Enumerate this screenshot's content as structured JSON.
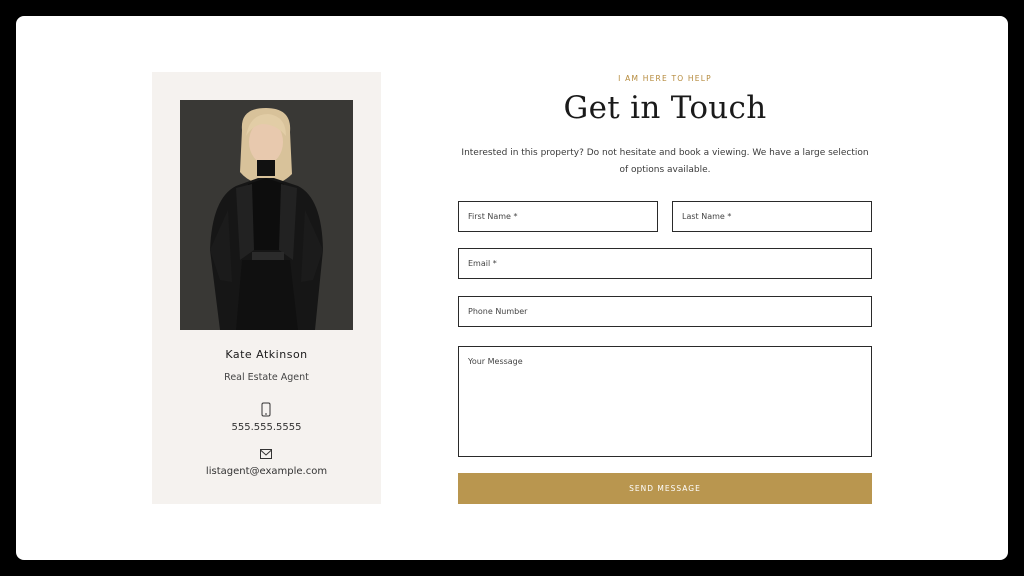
{
  "agent": {
    "name": "Kate Atkinson",
    "role": "Real Estate Agent",
    "phone": "555.555.5555",
    "email": "listagent@example.com",
    "phone_icon": "phone-icon",
    "email_icon": "mail-icon"
  },
  "contact": {
    "eyebrow": "I AM HERE TO HELP",
    "title": "Get in Touch",
    "intro": "Interested in this property? Do not hesitate and book a viewing. We have a large selection of options available.",
    "fields": {
      "first_name": "First Name *",
      "last_name": "Last Name *",
      "email": "Email *",
      "phone": "Phone Number",
      "message": "Your Message"
    },
    "submit_label": "SEND MESSAGE"
  },
  "colors": {
    "accent": "#b9964f",
    "card_background": "#f5f2ef",
    "eyebrow": "#b58a3c"
  }
}
